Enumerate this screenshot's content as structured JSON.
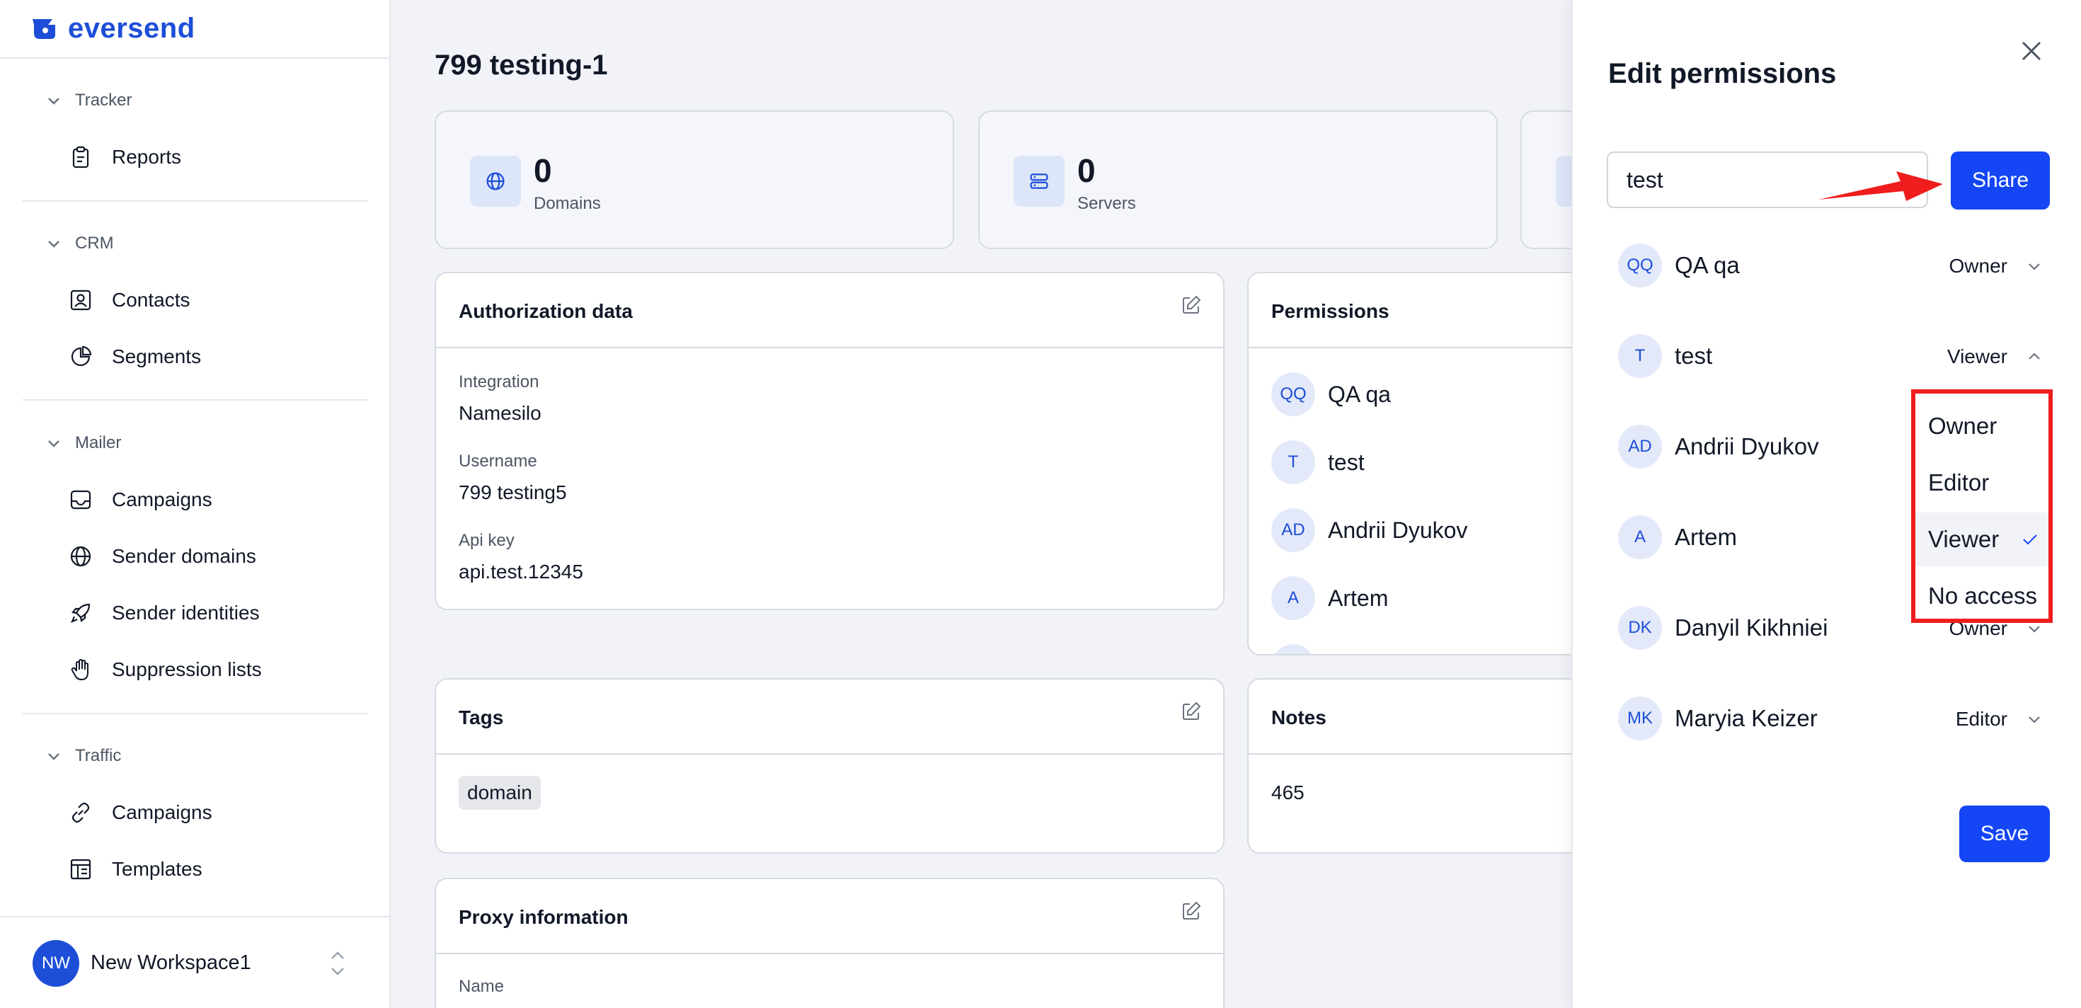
{
  "brand": {
    "name": "eversend"
  },
  "sidebar": {
    "sections": [
      {
        "label": "Tracker",
        "items": [
          {
            "label": "Reports",
            "icon": "clipboard-icon"
          }
        ]
      },
      {
        "label": "CRM",
        "items": [
          {
            "label": "Contacts",
            "icon": "contact-card-icon"
          },
          {
            "label": "Segments",
            "icon": "pie-chart-icon"
          }
        ]
      },
      {
        "label": "Mailer",
        "items": [
          {
            "label": "Campaigns",
            "icon": "inbox-icon"
          },
          {
            "label": "Sender domains",
            "icon": "globe-icon"
          },
          {
            "label": "Sender identities",
            "icon": "rocket-icon"
          },
          {
            "label": "Suppression lists",
            "icon": "hand-icon"
          }
        ]
      },
      {
        "label": "Traffic",
        "items": [
          {
            "label": "Campaigns",
            "icon": "link-icon"
          },
          {
            "label": "Templates",
            "icon": "template-icon"
          }
        ]
      }
    ],
    "workspace": {
      "initials": "NW",
      "name": "New Workspace1"
    }
  },
  "main": {
    "title": "799 testing-1",
    "stats": [
      {
        "value": "0",
        "label": "Domains",
        "icon": "globe-icon"
      },
      {
        "value": "0",
        "label": "Servers",
        "icon": "server-icon"
      }
    ],
    "authorization": {
      "title": "Authorization data",
      "fields": [
        {
          "label": "Integration",
          "value": "Namesilo"
        },
        {
          "label": "Username",
          "value": "799 testing5"
        },
        {
          "label": "Api key",
          "value": "api.test.12345"
        }
      ]
    },
    "permissions": {
      "title": "Permissions",
      "members": [
        {
          "initials": "QQ",
          "name": "QA qa"
        },
        {
          "initials": "T",
          "name": "test"
        },
        {
          "initials": "AD",
          "name": "Andrii Dyukov"
        },
        {
          "initials": "A",
          "name": "Artem"
        }
      ]
    },
    "tags": {
      "title": "Tags",
      "items": [
        "domain"
      ]
    },
    "notes": {
      "title": "Notes",
      "text": "465"
    },
    "proxy": {
      "title": "Proxy information",
      "first_field_label": "Name"
    }
  },
  "panel": {
    "title": "Edit permissions",
    "search_value": "test",
    "share_label": "Share",
    "save_label": "Save",
    "members": [
      {
        "initials": "QQ",
        "name": "QA qa",
        "role": "Owner",
        "expanded": false
      },
      {
        "initials": "T",
        "name": "test",
        "role": "Viewer",
        "expanded": true
      },
      {
        "initials": "AD",
        "name": "Andrii Dyukov",
        "role": "",
        "expanded": false
      },
      {
        "initials": "A",
        "name": "Artem",
        "role": "",
        "expanded": false
      },
      {
        "initials": "DK",
        "name": "Danyil Kikhniei",
        "role": "Owner",
        "expanded": false
      },
      {
        "initials": "MK",
        "name": "Maryia Keizer",
        "role": "Editor",
        "expanded": false
      }
    ],
    "role_options": [
      "Owner",
      "Editor",
      "Viewer",
      "No access"
    ],
    "selected_option": "Viewer"
  },
  "colors": {
    "accent": "#1446f5",
    "highlight": "#ef1d1d",
    "brand": "#1d4ed8"
  }
}
